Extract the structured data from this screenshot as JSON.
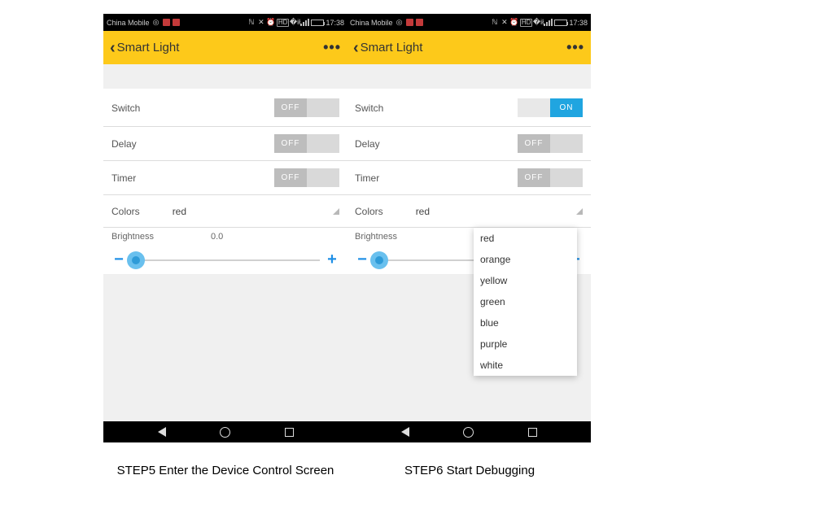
{
  "statusbar": {
    "carrier": "China Mobile",
    "time": "17:38",
    "hd_label": "HD"
  },
  "header": {
    "title": "Smart Light"
  },
  "labels": {
    "switch": "Switch",
    "delay": "Delay",
    "timer": "Timer",
    "colors": "Colors",
    "brightness": "Brightness",
    "off": "OFF",
    "on": "ON"
  },
  "left_pane": {
    "switch_on": false,
    "delay_on": false,
    "timer_on": false,
    "selected_color": "red",
    "brightness_value": "0.0"
  },
  "right_pane": {
    "switch_on": true,
    "delay_on": false,
    "timer_on": false,
    "selected_color": "red",
    "dropdown_open": true,
    "color_options": [
      "red",
      "orange",
      "yellow",
      "green",
      "blue",
      "purple",
      "white"
    ]
  },
  "captions": {
    "step5": "STEP5 Enter the Device Control Screen",
    "step6": "STEP6 Start Debugging"
  }
}
